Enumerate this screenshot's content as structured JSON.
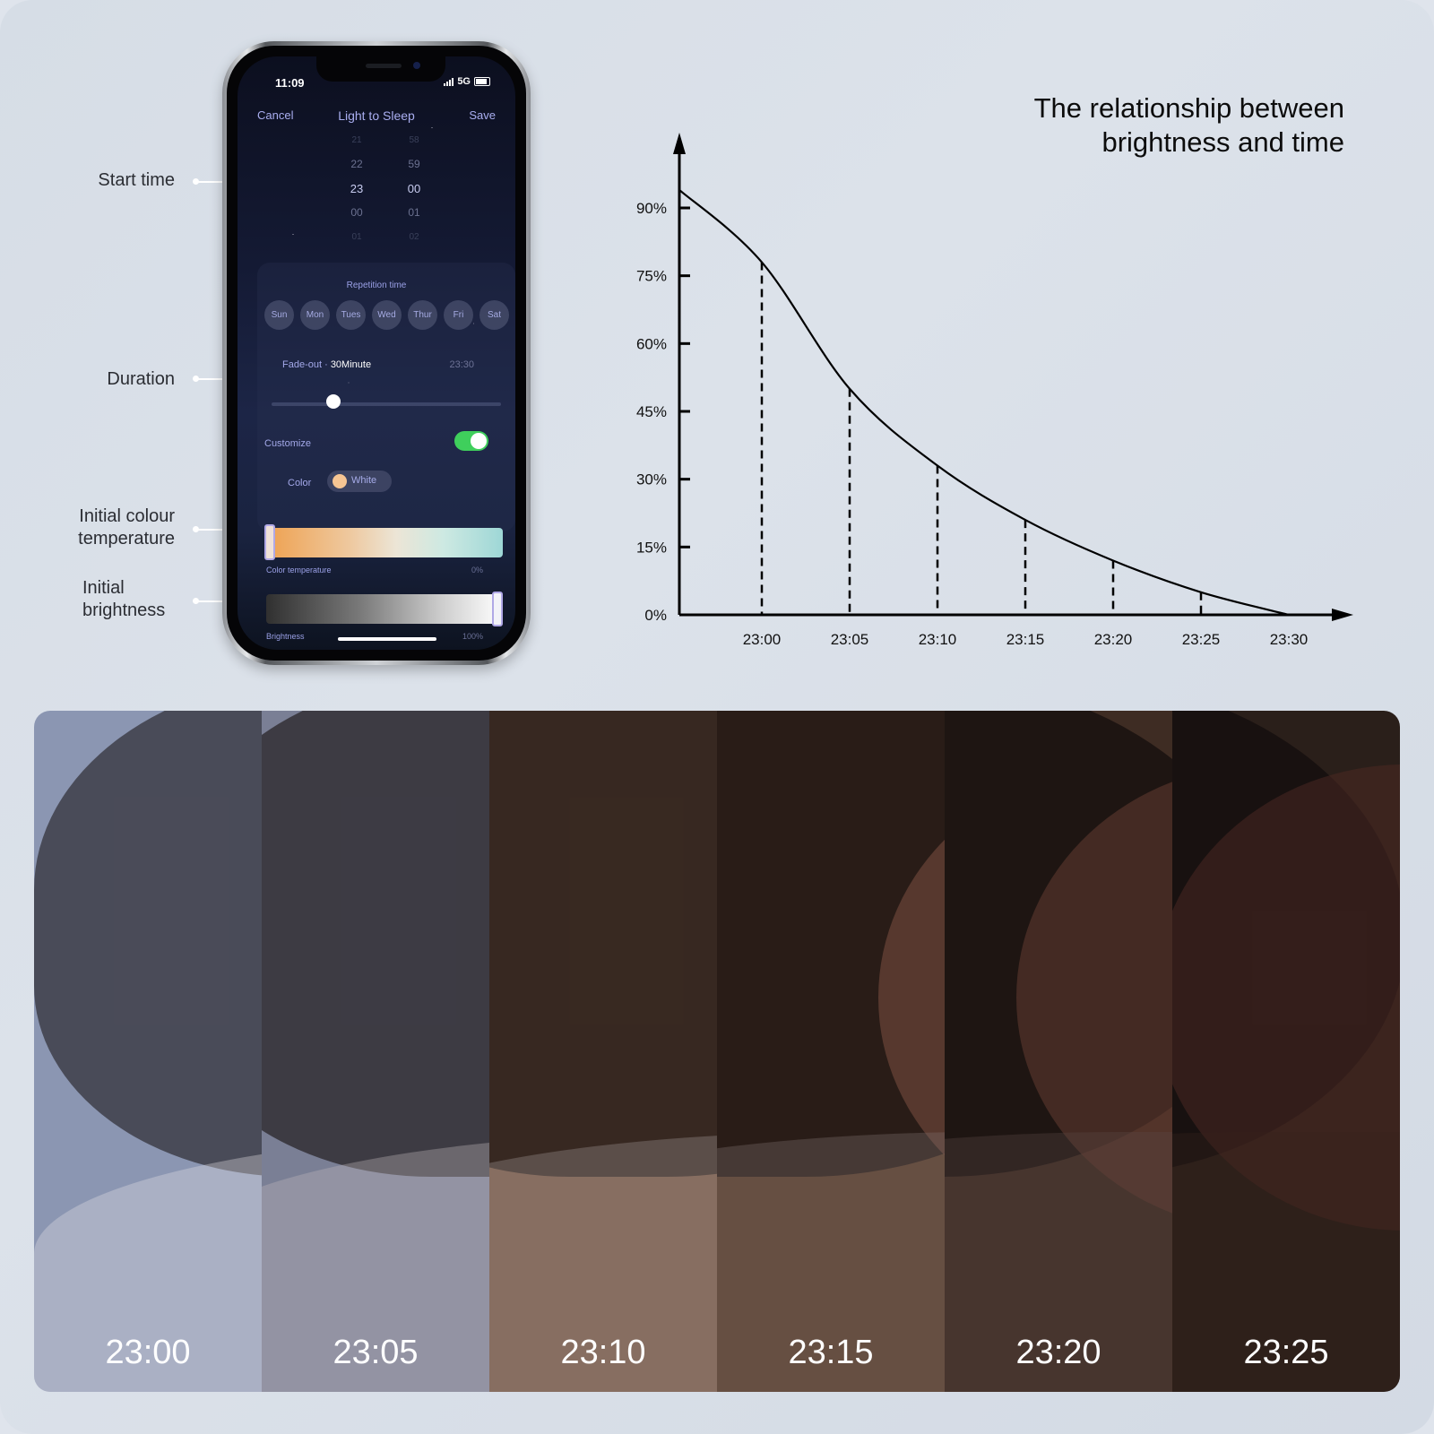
{
  "callouts": [
    {
      "id": "start-time",
      "lines": [
        "Start time"
      ]
    },
    {
      "id": "duration",
      "lines": [
        "Duration"
      ]
    },
    {
      "id": "initial-colour-temperature",
      "lines": [
        "Initial colour",
        "temperature"
      ]
    },
    {
      "id": "initial-brightness",
      "lines": [
        "Initial",
        "brightness"
      ]
    }
  ],
  "phone": {
    "status": {
      "time": "11:09",
      "network": "5G"
    },
    "nav": {
      "cancel": "Cancel",
      "title": "Light to Sleep",
      "save": "Save"
    },
    "picker": {
      "hours": [
        "21",
        "22",
        "23",
        "00",
        "01"
      ],
      "minutes": [
        "58",
        "59",
        "00",
        "01",
        "02"
      ],
      "selected_hour": "23",
      "selected_minute": "00"
    },
    "repetition": {
      "title": "Repetition time",
      "days": [
        "Sun",
        "Mon",
        "Tues",
        "Wed",
        "Thur",
        "Fri",
        "Sat"
      ]
    },
    "fade": {
      "label": "Fade-out · ",
      "value": "30Minute",
      "end_time": "23:30",
      "slider_fraction": 0.27
    },
    "customize": {
      "label": "Customize",
      "enabled": true,
      "color_on": "#3fcf5c"
    },
    "color": {
      "label": "Color",
      "name": "White",
      "swatch": "#f6c593"
    },
    "color_temperature": {
      "label": "Color temperature",
      "value": "0%",
      "fraction": 0.0
    },
    "brightness": {
      "label": "Brightness",
      "value": "100%",
      "fraction": 1.0
    }
  },
  "chart_data": {
    "type": "line",
    "title": "The relationship between brightness and time",
    "title_lines": [
      "The relationship between",
      "brightness and time"
    ],
    "xlabel": "",
    "ylabel": "",
    "x": [
      "23:00",
      "23:05",
      "23:10",
      "23:15",
      "23:20",
      "23:25",
      "23:30"
    ],
    "x_minutes": [
      0,
      5,
      10,
      15,
      20,
      25,
      30
    ],
    "series": [
      {
        "name": "brightness",
        "values": [
          78,
          50,
          33,
          21,
          12,
          5,
          0
        ]
      }
    ],
    "curve_start": {
      "x_minutes": -4.7,
      "value": 94
    },
    "yticks": [
      0,
      15,
      30,
      45,
      60,
      75,
      90
    ],
    "ytick_labels": [
      "0%",
      "15%",
      "30%",
      "45%",
      "60%",
      "75%",
      "90%"
    ],
    "ylim": [
      0,
      100
    ],
    "dashed_drops": true,
    "grid": false,
    "legend": "none"
  },
  "photo_strip": {
    "segments": [
      {
        "label": "23:00",
        "tone": "#8b96b2"
      },
      {
        "label": "23:05",
        "tone": "#7a7f95"
      },
      {
        "label": "23:10",
        "tone": "#7a5a45"
      },
      {
        "label": "23:15",
        "tone": "#5a3e2c"
      },
      {
        "label": "23:20",
        "tone": "#3e2c23"
      },
      {
        "label": "23:25",
        "tone": "#2a1f1a"
      }
    ]
  }
}
